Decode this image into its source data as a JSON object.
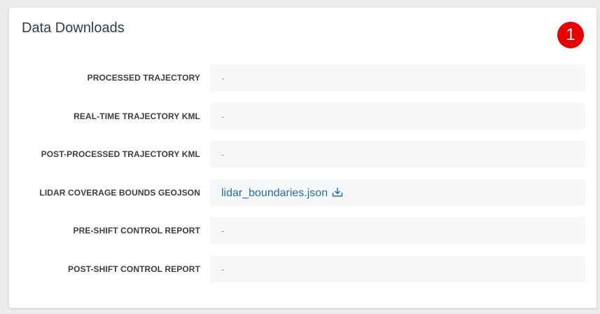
{
  "panel": {
    "title": "Data Downloads",
    "badge": "1"
  },
  "rows": [
    {
      "label": "PROCESSED TRAJECTORY",
      "value": "-"
    },
    {
      "label": "REAL-TIME TRAJECTORY KML",
      "value": "-"
    },
    {
      "label": "POST-PROCESSED TRAJECTORY KML",
      "value": "-"
    },
    {
      "label": "LIDAR COVERAGE BOUNDS GEOJSON",
      "value": "lidar_boundaries.json",
      "icon": "download-icon"
    },
    {
      "label": "PRE-SHIFT CONTROL REPORT",
      "value": "-"
    },
    {
      "label": "POST-SHIFT CONTROL REPORT",
      "value": "-"
    }
  ],
  "colors": {
    "badge": "#e60000",
    "link": "#1f6fb5",
    "value_background": "#f6f7f9"
  }
}
